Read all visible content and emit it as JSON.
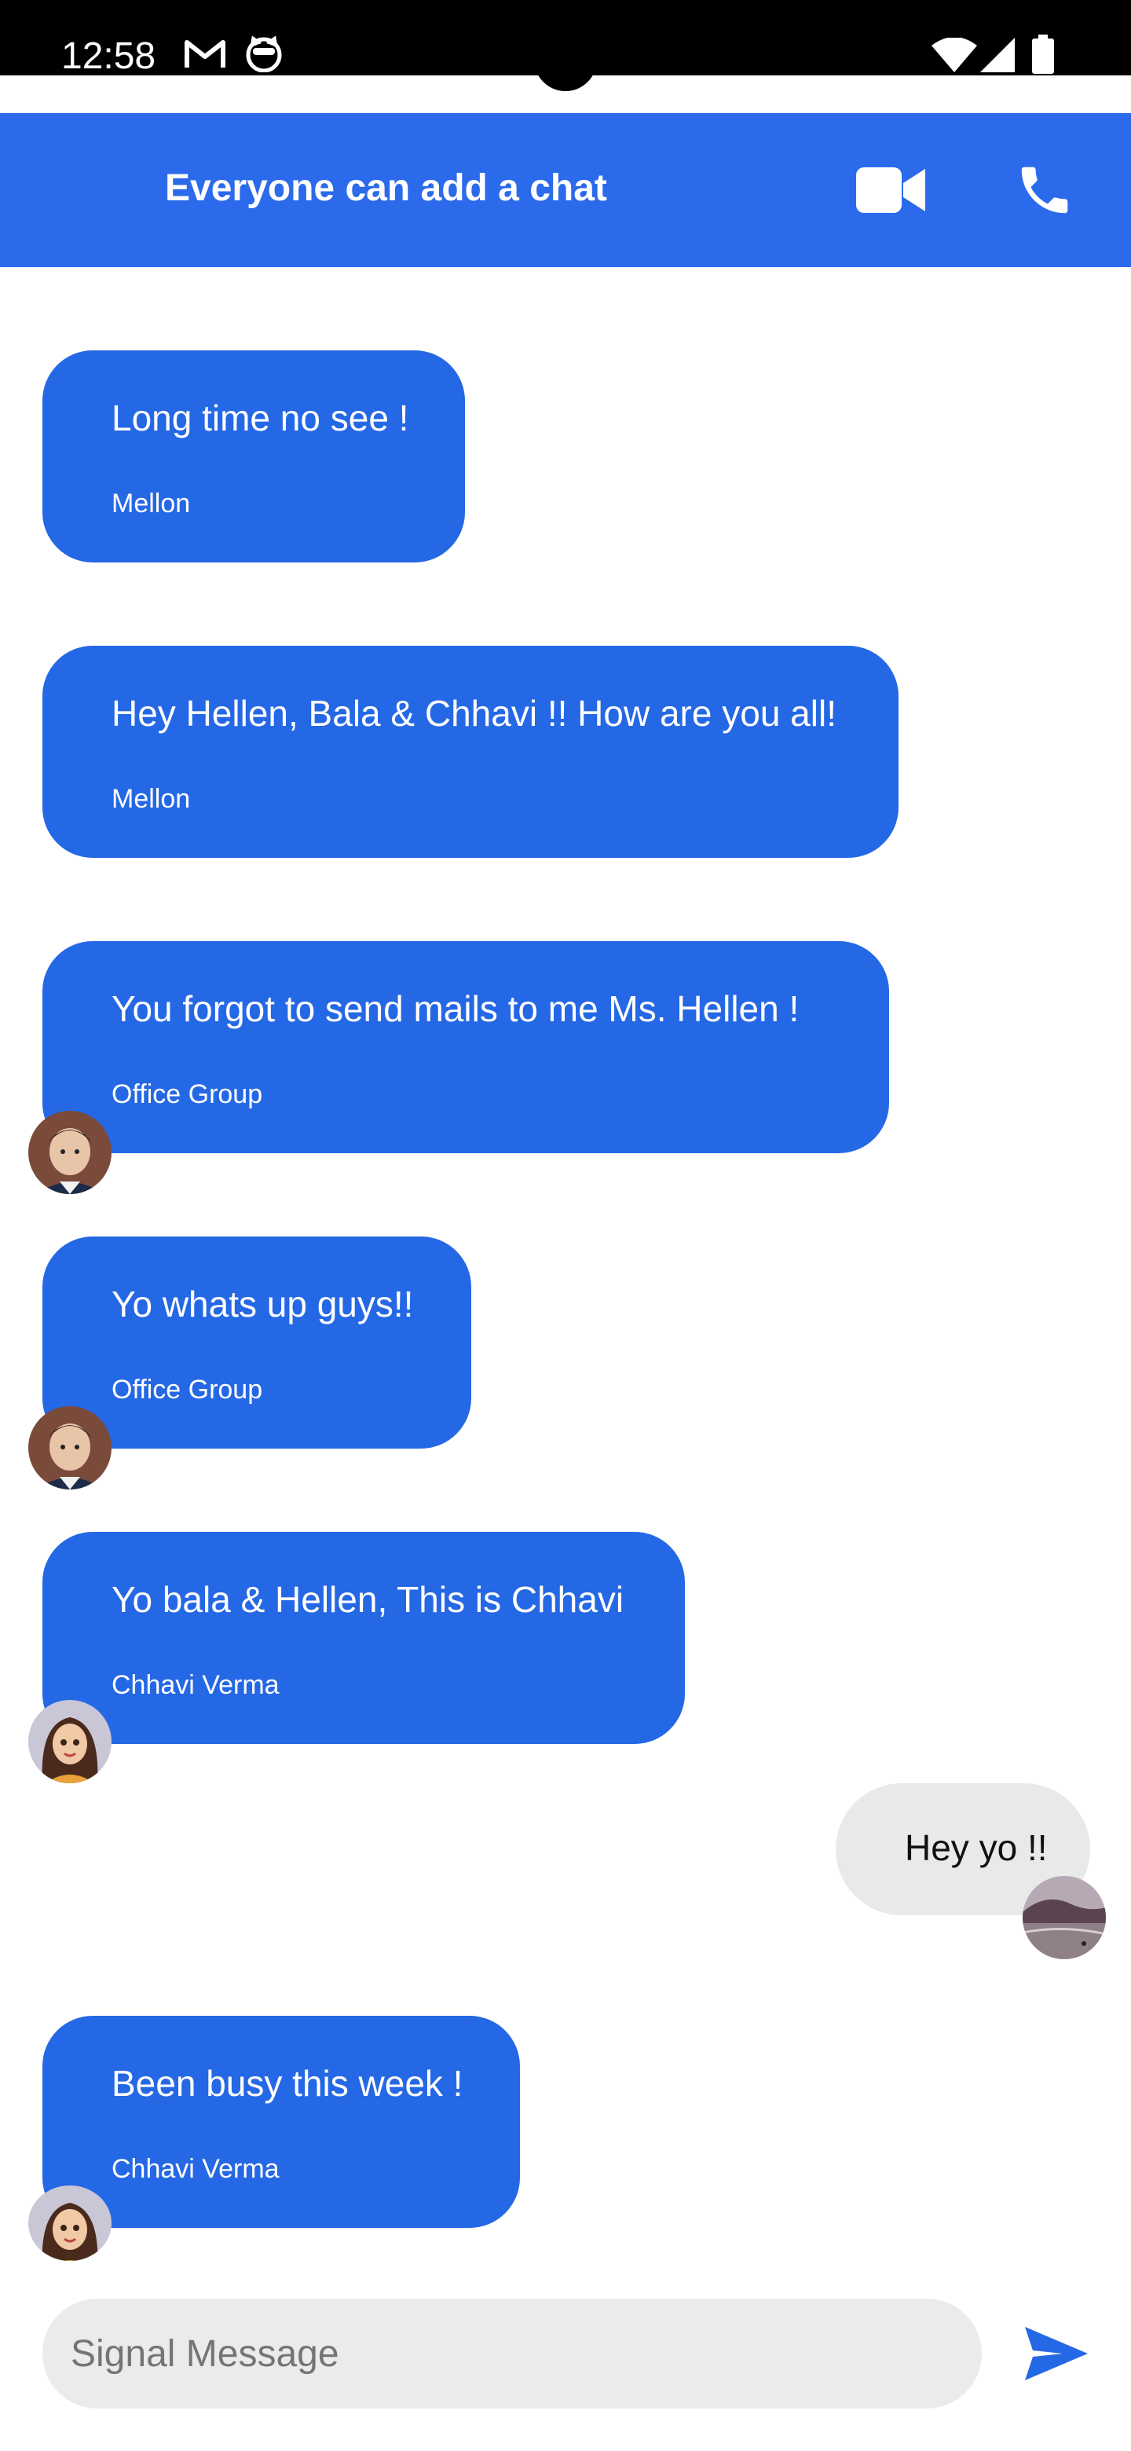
{
  "status_bar": {
    "time": "12:58",
    "notification_icons": [
      "gmail-icon",
      "cat-app-icon"
    ],
    "system_icons": [
      "wifi-icon",
      "cellular-signal-icon",
      "battery-icon"
    ]
  },
  "header": {
    "title": "Everyone can add a chat",
    "background_color": "#2b6beb",
    "actions": [
      "video-call-icon",
      "phone-call-icon"
    ]
  },
  "messages": [
    {
      "text": "Long time no see !",
      "sender": "Mellon",
      "direction": "incoming",
      "avatar": null
    },
    {
      "text": "Hey Hellen, Bala & Chhavi !! How are you all!",
      "sender": "Mellon",
      "direction": "incoming",
      "avatar": null
    },
    {
      "text": "You forgot to send mails to me Ms. Hellen !",
      "sender": "Office Group",
      "direction": "incoming",
      "avatar": "boy-avatar"
    },
    {
      "text": "Yo whats up guys!!",
      "sender": "Office Group",
      "direction": "incoming",
      "avatar": "boy-avatar"
    },
    {
      "text": "Yo bala & Hellen, This is Chhavi",
      "sender": "Chhavi Verma",
      "direction": "incoming",
      "avatar": "girl-avatar"
    },
    {
      "text": "Hey yo !!",
      "sender": "",
      "direction": "outgoing",
      "avatar": "beach-avatar"
    },
    {
      "text": "Been busy this week !",
      "sender": "Chhavi Verma",
      "direction": "incoming",
      "avatar": "girl-avatar"
    }
  ],
  "colors": {
    "incoming_bubble": "#2568e5",
    "outgoing_bubble": "#e9e9e9",
    "accent": "#2b6beb"
  },
  "composer": {
    "placeholder": "Signal Message",
    "value": "",
    "send_icon": "send-icon"
  }
}
